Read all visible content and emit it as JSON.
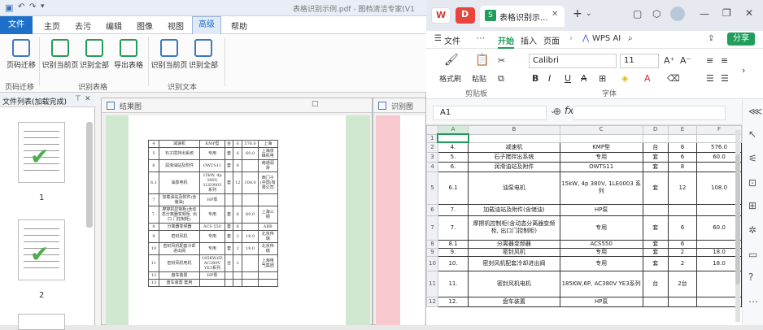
{
  "left_app": {
    "title": "表格识别示例.pdf - 图档清洁专家(V1",
    "menu": [
      "文件",
      "主页",
      "去污",
      "编辑",
      "图像",
      "视图",
      "高级",
      "帮助"
    ],
    "ribbon": {
      "buttons": [
        "页码迁移",
        "识别当前页",
        "识别全部",
        "导出表格",
        "识别当前页",
        "识别全部"
      ],
      "groups": [
        "页码迁移",
        "识别表格",
        "识别文本"
      ]
    },
    "file_list": {
      "header": "文件列表(加载完成)",
      "pages": [
        "1",
        "2"
      ]
    },
    "panes": {
      "result": "结果图",
      "recognize": "识别图"
    },
    "scan_rows": [
      [
        "4",
        "减速机",
        "KMP型",
        "台",
        "6",
        "576.0",
        "上海"
      ],
      [
        "5",
        "石子搅拌出系统",
        "专用",
        "套",
        "6",
        "60.0",
        "上海泉峰机电"
      ],
      [
        "6",
        "润滑油站及附件",
        "OWTS11",
        "套",
        "8",
        "",
        "南通润滑"
      ],
      [
        "6.1",
        "油泵电机",
        "15kW, 4p 380V, 1LE0003 系列",
        "套",
        "12",
        "108.0",
        "西门子(中国)有限公司"
      ],
      [
        "7",
        "加载油站及附件(含 储油)",
        "HP泵",
        "",
        "",
        "",
        ""
      ],
      [
        "7.",
        "摩擦机控制柜(含动 态分离器变频柜, 出口 门控制柜)",
        "专用",
        "套",
        "6",
        "60.0",
        "上海三钢"
      ],
      [
        "8",
        "分离器变频器",
        "ACS 550",
        "套",
        "6",
        "",
        "ABB"
      ],
      [
        "9",
        "密封风机",
        "专用",
        "套",
        "2",
        "18.0",
        "北京伟瑞"
      ],
      [
        "10",
        "密封风机配套冷却 进出阀",
        "专用",
        "套",
        "2",
        "18.0",
        "北京伟瑞"
      ],
      [
        "11",
        "密封风机电机",
        "185KW,6P, AC380V YE3系列",
        "台",
        "2",
        "",
        "上海电气集团"
      ],
      [
        "12",
        "盘车装置",
        "HP泵",
        "",
        "",
        "",
        ""
      ],
      [
        "13",
        "盘车装置 套用",
        "",
        "",
        "",
        "",
        ""
      ]
    ]
  },
  "right_app": {
    "doc_tab": "表格识别示...",
    "menu": [
      "文件",
      "开始",
      "插入",
      "页面",
      "WPS AI",
      "分享"
    ],
    "ribbon": {
      "format_brush": "格式刷",
      "paste": "粘贴",
      "clipboard_group": "剪贴板",
      "font_name": "Calibri",
      "font_size": "11",
      "font_group": "字体"
    },
    "name_box": "A1",
    "fx": "fx",
    "col_headers": [
      "",
      "A",
      "B",
      "C",
      "D",
      "E",
      "F"
    ],
    "rows": [
      {
        "rn": "1",
        "cells": [
          "",
          "",
          "",
          "",
          "",
          ""
        ]
      },
      {
        "rn": "2",
        "cells": [
          "4.",
          "减速机",
          "KMP型",
          "台",
          "6",
          "576.0"
        ]
      },
      {
        "rn": "3",
        "cells": [
          "5.",
          "石子搅拌出系统",
          "专用",
          "套",
          "6",
          "60.0"
        ]
      },
      {
        "rn": "4",
        "cells": [
          "6.",
          "润滑油站及附件",
          "OWTS11",
          "套",
          "8",
          ""
        ]
      },
      {
        "rn": "5",
        "cells": [
          "6.1",
          "油泵电机",
          "15kW, 4p 380V, 1LE0003 系列",
          "套",
          "12",
          "108.0"
        ]
      },
      {
        "rn": "6",
        "cells": [
          "7.",
          "加载油站及附件(含储油)",
          "HP泵",
          "",
          "",
          ""
        ]
      },
      {
        "rn": "7",
        "cells": [
          "7.",
          "摩擦机控制柜(含动态分离器变频柜, 出口门控制柜)",
          "专用",
          "套",
          "6",
          "60.0"
        ]
      },
      {
        "rn": "8",
        "cells": [
          "8.1",
          "分离器变频器",
          "ACS550",
          "套",
          "6",
          ""
        ]
      },
      {
        "rn": "9",
        "cells": [
          "9.",
          "密封风机",
          "专用",
          "套",
          "2",
          "18.0"
        ]
      },
      {
        "rn": "10",
        "cells": [
          "10.",
          "密封风机配套冷却进出阀",
          "专用",
          "套",
          "2",
          "18.0"
        ]
      },
      {
        "rn": "11",
        "cells": [
          "11.",
          "密封风机电机",
          "185KW,6P, AC380V YE3系列",
          "台",
          "2台",
          ""
        ]
      },
      {
        "rn": "12",
        "cells": [
          "12.",
          "盘车装置",
          "HP泵",
          "",
          "",
          ""
        ]
      }
    ]
  }
}
